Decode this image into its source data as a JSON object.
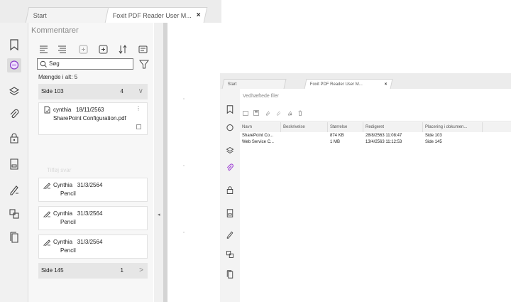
{
  "left_window": {
    "tabs": [
      {
        "label": "Start",
        "active": false
      },
      {
        "label": "Foxit PDF Reader User M...",
        "active": true,
        "close": "×"
      }
    ],
    "sidebar_icons": [
      "bookmark-icon",
      "comment-icon",
      "layers-icon",
      "attachment-icon",
      "lock-icon",
      "form-icon",
      "signature-icon",
      "compare-icon",
      "pages-icon"
    ],
    "panel_title": "Kommentarer",
    "search_placeholder": "Søg",
    "total_label": "Mængde i alt: 5",
    "groups": [
      {
        "page": "Side 103",
        "count": "4",
        "chevron": "∨"
      },
      {
        "page": "Side 145",
        "count": "1",
        "chevron": ">"
      }
    ],
    "cards": [
      {
        "author": "cynthia",
        "date": "18/11/2563",
        "body": "SharePoint Configuration.pdf",
        "menu": "⋮"
      },
      {
        "author": "Cynthia",
        "date": "31/3/2564",
        "body": "Pencil"
      },
      {
        "author": "Cynthia",
        "date": "31/3/2564",
        "body": "Pencil"
      },
      {
        "author": "Cynthia",
        "date": "31/3/2564",
        "body": "Pencil"
      }
    ],
    "ghost_text": "Tilføj svar",
    "collapse_caret": "◂"
  },
  "right_window": {
    "tabs": [
      {
        "label": "Start",
        "active": false
      },
      {
        "label": "Foxit PDF Reader User M...",
        "active": true,
        "close": "×"
      }
    ],
    "panel_title": "Vedhæftede filer",
    "columns": [
      "Navn",
      "Beskrivelse",
      "Størrelse",
      "Redigeret",
      "Placering i dokumen..."
    ],
    "rows": [
      {
        "name": "SharePoint Co...",
        "description": "",
        "size": "874 KB",
        "modified": "28/8/2563 11:08:47",
        "location": "Side 103"
      },
      {
        "name": "Web Service C...",
        "description": "",
        "size": "1 MB",
        "modified": "13/4/2563 11:12:53",
        "location": "Side 145"
      }
    ]
  }
}
